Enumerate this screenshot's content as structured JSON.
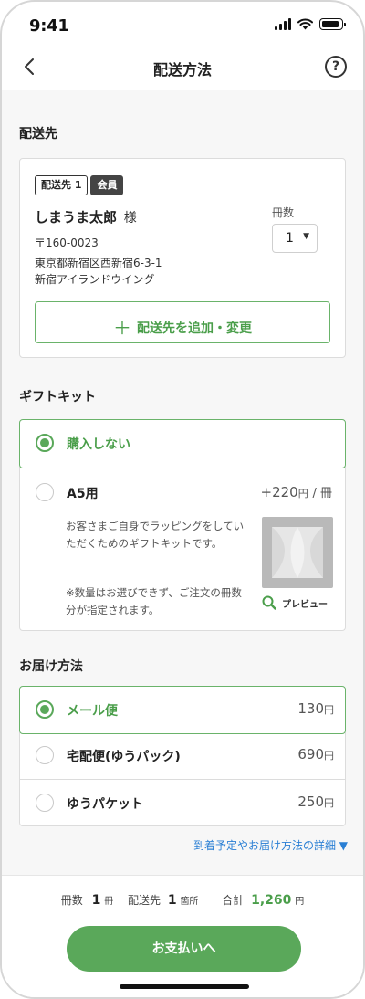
{
  "status_bar": {
    "time": "9:41"
  },
  "nav": {
    "title": "配送方法",
    "help_symbol": "?"
  },
  "destination_section": {
    "title": "配送先",
    "tag_primary": "配送先 1",
    "tag_member": "会員",
    "recipient_name": "しまうま太郎",
    "honorific": "様",
    "postal_code": "〒160-0023",
    "address_line1": "東京都新宿区西新宿6-3-1",
    "address_line2": "新宿アイランドウイング",
    "copies_label": "冊数",
    "copies_value": "1",
    "add_button_label": "配送先を追加・変更"
  },
  "gift_section": {
    "title": "ギフトキット",
    "option_none_label": "購入しない",
    "option_a5_label": "A5用",
    "option_a5_price": "+220",
    "option_a5_unit": "円",
    "option_a5_per": "/ 冊",
    "description1": "お客さまご自身でラッピングをしていただくためのギフトキットです。",
    "description2": "※数量はお選びできず、ご注文の冊数分が指定されます。",
    "preview_label": "プレビュー"
  },
  "delivery_section": {
    "title": "お届け方法",
    "options": [
      {
        "label": "メール便",
        "price": "130",
        "unit": "円",
        "selected": true
      },
      {
        "label": "宅配便(ゆうパック)",
        "price": "690",
        "unit": "円",
        "selected": false
      },
      {
        "label": "ゆうパケット",
        "price": "250",
        "unit": "円",
        "selected": false
      }
    ],
    "details_link": "到着予定やお届け方法の詳細 ▼"
  },
  "footer": {
    "copies_label": "冊数",
    "copies_value": "1",
    "copies_unit": "冊",
    "dest_label": "配送先",
    "dest_value": "1",
    "dest_unit": "箇所",
    "total_label": "合計",
    "total_value": "1,260",
    "total_unit": "円",
    "pay_button": "お支払いへ"
  },
  "colors": {
    "accent": "#5aa85a",
    "link": "#2a7fd4"
  }
}
